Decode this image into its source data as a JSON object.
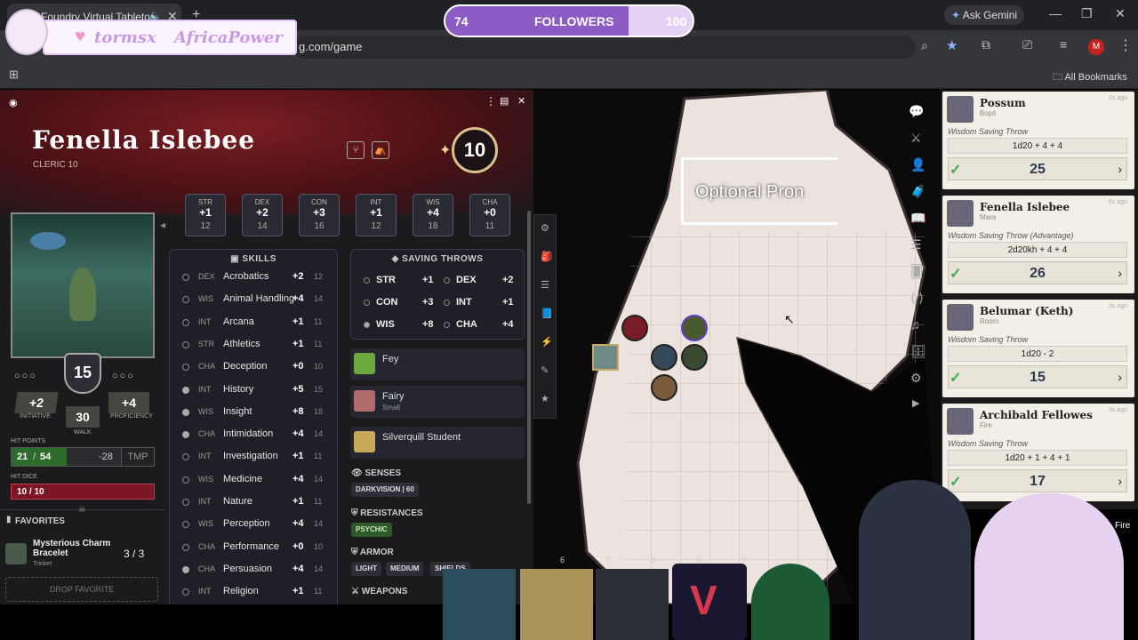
{
  "browser": {
    "tab_title": "Foundry Virtual Tabletop",
    "url_visible": "g.com/game",
    "ask_gemini": "Ask Gemini",
    "all_bookmarks": "All Bookmarks",
    "profile_initial": "M"
  },
  "stream": {
    "followers_current": "74",
    "followers_label": "FOLLOWERS",
    "followers_goal": "100",
    "followers_fraction": 0.74,
    "overlay_names": [
      "tormsx",
      "AfricaPower"
    ]
  },
  "character": {
    "name": "Fenella Islebee",
    "class_level": "CLERIC 10",
    "level": "10",
    "abilities": [
      {
        "abbr": "STR",
        "mod": "+1",
        "score": "12"
      },
      {
        "abbr": "DEX",
        "mod": "+2",
        "score": "14"
      },
      {
        "abbr": "CON",
        "mod": "+3",
        "score": "16"
      },
      {
        "abbr": "INT",
        "mod": "+1",
        "score": "12"
      },
      {
        "abbr": "WIS",
        "mod": "+4",
        "score": "18"
      },
      {
        "abbr": "CHA",
        "mod": "+0",
        "score": "11"
      }
    ],
    "ac": "15",
    "initiative": {
      "value": "+2",
      "label": "INITIATIVE"
    },
    "walk": {
      "value": "30",
      "label": "WALK"
    },
    "proficiency": {
      "value": "+4",
      "label": "PROFICIENCY"
    },
    "hit_points": {
      "label": "HIT POINTS",
      "current": "21",
      "max": "54",
      "temp_change": "-28",
      "tmp_label": "TMP"
    },
    "hit_dice": {
      "label": "HIT DICE",
      "value": "10 / 10"
    },
    "favorites": {
      "label": "FAVORITES",
      "item_name": "Mysterious Charm Bracelet",
      "item_type": "Trinket",
      "item_uses": "3 / 3",
      "drop_label": "DROP FAVORITE"
    },
    "skills_title": "SKILLS",
    "skills": [
      {
        "ab": "DEX",
        "name": "Acrobatics",
        "bonus": "+2",
        "passive": "12",
        "prof": false
      },
      {
        "ab": "WIS",
        "name": "Animal Handling",
        "bonus": "+4",
        "passive": "14",
        "prof": false
      },
      {
        "ab": "INT",
        "name": "Arcana",
        "bonus": "+1",
        "passive": "11",
        "prof": false
      },
      {
        "ab": "STR",
        "name": "Athletics",
        "bonus": "+1",
        "passive": "11",
        "prof": false
      },
      {
        "ab": "CHA",
        "name": "Deception",
        "bonus": "+0",
        "passive": "10",
        "prof": false
      },
      {
        "ab": "INT",
        "name": "History",
        "bonus": "+5",
        "passive": "15",
        "prof": true
      },
      {
        "ab": "WIS",
        "name": "Insight",
        "bonus": "+8",
        "passive": "18",
        "prof": true
      },
      {
        "ab": "CHA",
        "name": "Intimidation",
        "bonus": "+4",
        "passive": "14",
        "prof": true
      },
      {
        "ab": "INT",
        "name": "Investigation",
        "bonus": "+1",
        "passive": "11",
        "prof": false
      },
      {
        "ab": "WIS",
        "name": "Medicine",
        "bonus": "+4",
        "passive": "14",
        "prof": false
      },
      {
        "ab": "INT",
        "name": "Nature",
        "bonus": "+1",
        "passive": "11",
        "prof": false
      },
      {
        "ab": "WIS",
        "name": "Perception",
        "bonus": "+4",
        "passive": "14",
        "prof": false
      },
      {
        "ab": "CHA",
        "name": "Performance",
        "bonus": "+0",
        "passive": "10",
        "prof": false
      },
      {
        "ab": "CHA",
        "name": "Persuasion",
        "bonus": "+4",
        "passive": "14",
        "prof": true
      },
      {
        "ab": "INT",
        "name": "Religion",
        "bonus": "+1",
        "passive": "11",
        "prof": false
      }
    ],
    "saves_title": "SAVING THROWS",
    "saves": [
      {
        "abbr": "STR",
        "bonus": "+1"
      },
      {
        "abbr": "DEX",
        "bonus": "+2"
      },
      {
        "abbr": "CON",
        "bonus": "+3"
      },
      {
        "abbr": "INT",
        "bonus": "+1"
      },
      {
        "abbr": "WIS",
        "bonus": "+8"
      },
      {
        "abbr": "CHA",
        "bonus": "+4"
      }
    ],
    "traits": [
      {
        "title": "Fey",
        "sub": ""
      },
      {
        "title": "Fairy",
        "sub": "Small"
      },
      {
        "title": "Silverquill Student",
        "sub": ""
      }
    ],
    "senses_title": "SENSES",
    "senses": "DARKVISION | 60",
    "resistances_title": "RESISTANCES",
    "resistances": "PSYCHIC",
    "armor_title": "ARMOR",
    "armor": [
      "LIGHT",
      "MEDIUM",
      "SHIELDS"
    ],
    "weapons_title": "WEAPONS"
  },
  "map": {
    "label": "Optional Pron",
    "ruler_numbers": [
      "6",
      "7",
      "8",
      "9",
      "0"
    ]
  },
  "rolls": [
    {
      "name": "Possum",
      "note": "Bopit",
      "time": "2s ago",
      "type": "Wisdom Saving Throw",
      "formula": "1d20 + 4 + 4",
      "result": "25"
    },
    {
      "name": "Fenella Islebee",
      "note": "Mara",
      "time": "6s ago",
      "type": "Wisdom Saving Throw (Advantage)",
      "formula": "2d20kh + 4 + 4",
      "result": "26"
    },
    {
      "name": "Belumar (Keth)",
      "note": "Room",
      "time": "3s ago",
      "type": "Wisdom Saving Throw",
      "formula": "1d20 - 2",
      "result": "15"
    },
    {
      "name": "Archibald Fellowes",
      "note": "Fire",
      "time": "3s ago",
      "type": "Wisdom Saving Throw",
      "formula": "1d20 + 1 + 4 + 1",
      "result": "17"
    }
  ],
  "fire_label": "Fire"
}
